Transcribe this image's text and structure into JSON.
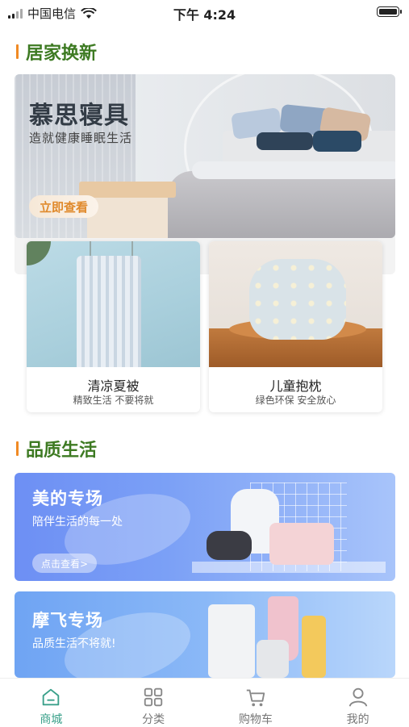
{
  "status_bar": {
    "carrier": "中国电信",
    "time": "下午 4:24"
  },
  "section_home": {
    "title": "居家换新"
  },
  "hero": {
    "title": "慕思寝具",
    "subtitle": "造就健康睡眠生活",
    "button_label": "立即查看"
  },
  "products": [
    {
      "name": "清凉夏被",
      "desc": "精致生活 不要将就"
    },
    {
      "name": "儿童抱枕",
      "desc": "绿色环保 安全放心"
    }
  ],
  "section_quality": {
    "title": "品质生活"
  },
  "brands": [
    {
      "title": "美的专场",
      "subtitle": "陪伴生活的每一处",
      "button_label": "点击查看>"
    },
    {
      "title": "摩飞专场",
      "subtitle": "品质生活不将就!"
    }
  ],
  "tab_bar": {
    "active_color": "#3aa08a",
    "items": [
      {
        "label": "商城",
        "icon": "home-icon",
        "active": true
      },
      {
        "label": "分类",
        "icon": "grid-icon",
        "active": false
      },
      {
        "label": "购物车",
        "icon": "cart-icon",
        "active": false
      },
      {
        "label": "我的",
        "icon": "user-icon",
        "active": false
      }
    ]
  }
}
